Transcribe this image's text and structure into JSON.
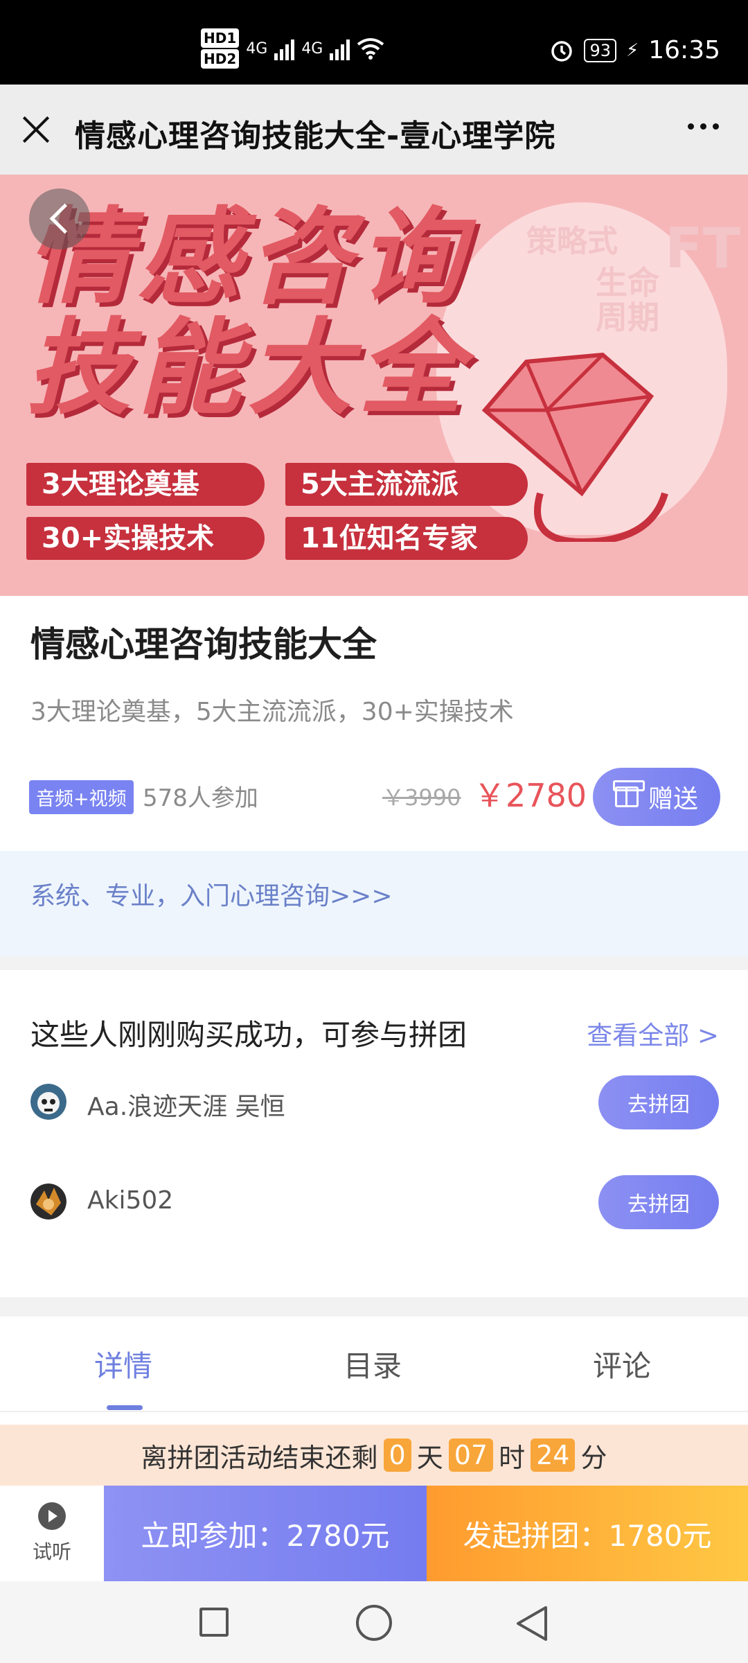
{
  "status_bar": {
    "time": "16:35",
    "battery": "93",
    "network_1": "4G",
    "network_2": "4G",
    "hd1": "HD1",
    "hd2": "HD2"
  },
  "title_bar": {
    "title": "情感心理咨询技能大全-壹心理学院"
  },
  "banner": {
    "line1": "情感咨询",
    "line2": "技能大全",
    "pills": [
      "3大理论奠基",
      "5大主流流派",
      "30+实操技术",
      "11位知名专家"
    ],
    "watermark": [
      "策略式",
      "生命",
      "周期",
      "FT"
    ]
  },
  "course": {
    "title": "情感心理咨询技能大全",
    "subtitle": "3大理论奠基，5大主流流派，30+实操技术",
    "tag": "音频+视频",
    "participants": "578人参加",
    "old_price": "￥3990",
    "price": "￥2780",
    "gift_label": "赠送"
  },
  "promo": {
    "link": "系统、专业，入门心理咨询>>>"
  },
  "group_buy": {
    "title": "这些人刚刚购买成功，可参与拼团",
    "view_all": "查看全部 >",
    "buyers": [
      {
        "name": "Aa.浪迹天涯 吴恒",
        "button": "去拼团"
      },
      {
        "name": "Aki502",
        "button": "去拼团"
      }
    ]
  },
  "tabs": [
    {
      "label": "详情",
      "active": true
    },
    {
      "label": "目录",
      "active": false
    },
    {
      "label": "评论",
      "active": false
    }
  ],
  "countdown": {
    "prefix": "离拼团活动结束还剩",
    "days": "0",
    "days_unit": "天",
    "hours": "07",
    "hours_unit": "时",
    "minutes": "24",
    "minutes_unit": "分"
  },
  "actions": {
    "trial": "试听",
    "join_now": "立即参加：2780元",
    "start_group": "发起拼团：1780元"
  },
  "colors": {
    "accent": "#7a83f0",
    "price": "#e8545a",
    "orange": "#ffb23a"
  }
}
